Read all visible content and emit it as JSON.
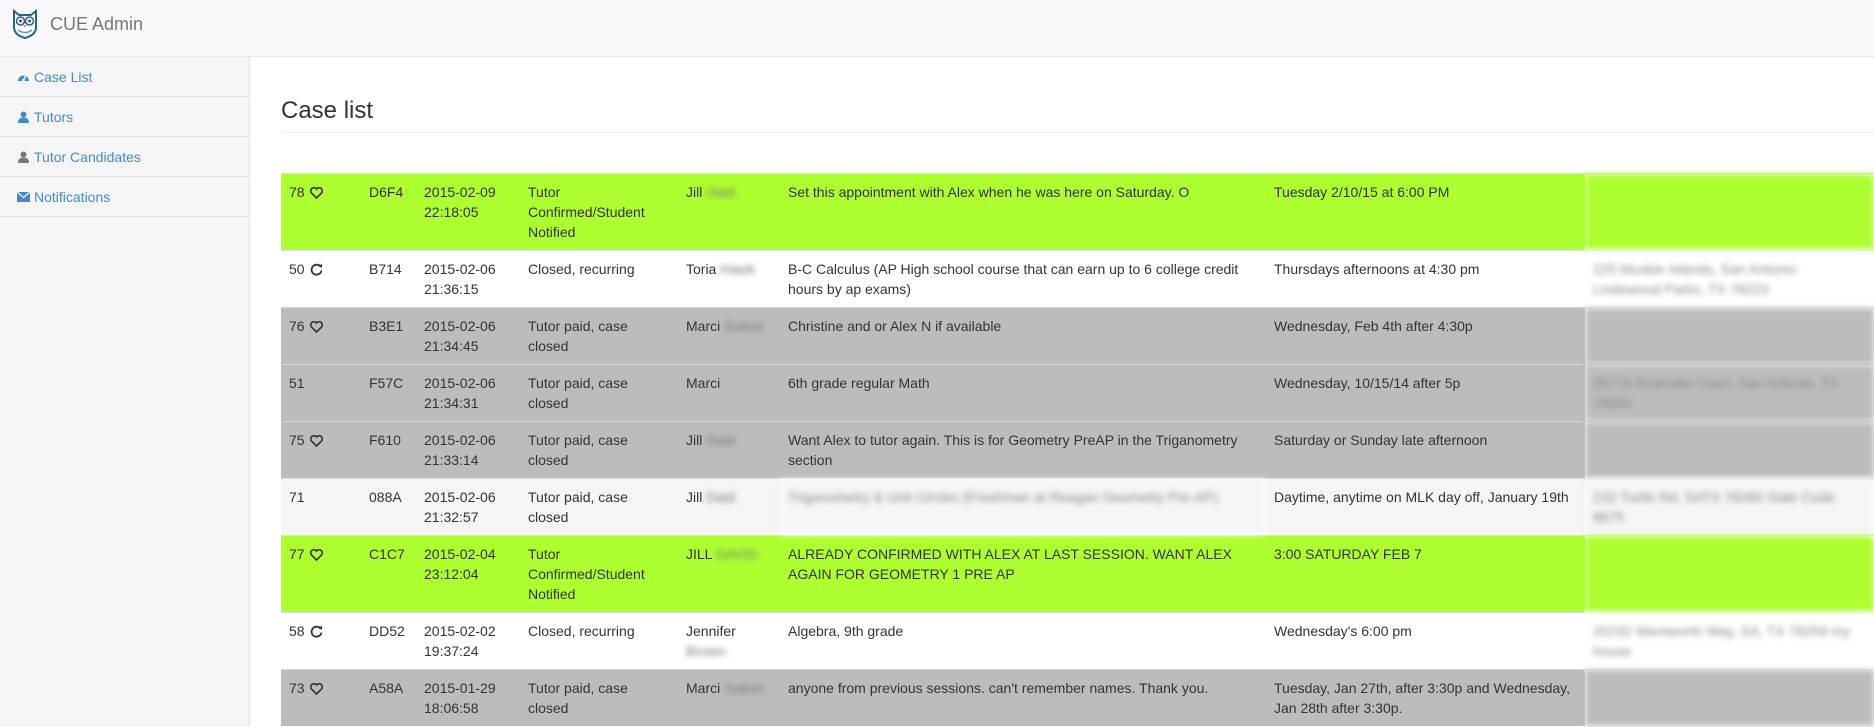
{
  "app": {
    "title": "CUE Admin",
    "logo_icon": "owl-logo-icon"
  },
  "sidebar": {
    "items": [
      {
        "label": "Case List",
        "icon": "dashboard-icon"
      },
      {
        "label": "Tutors",
        "icon": "user-icon"
      },
      {
        "label": "Tutor Candidates",
        "icon": "user-icon"
      },
      {
        "label": "Notifications",
        "icon": "envelope-icon"
      }
    ]
  },
  "page": {
    "title": "Case list"
  },
  "colors": {
    "confirmed": "#adff2f",
    "closed_paid": "#bcbcbc",
    "link": "#428bca"
  },
  "cases": [
    {
      "id": "78",
      "icon": "heart",
      "code": "D6F4",
      "date": "2015-02-09",
      "time": "22:18:05",
      "status": "Tutor Confirmed/Student Notified",
      "name": "Jill",
      "name_hidden": "Daid",
      "name_hidden2": "",
      "note": "Set this appointment with Alex when he was here on Saturday. O",
      "schedule": "Tuesday 2/10/15 at 6:00 PM",
      "address": "",
      "row": "green"
    },
    {
      "id": "50",
      "icon": "refresh",
      "code": "B714",
      "date": "2015-02-06",
      "time": "21:36:15",
      "status": "Closed, recurring",
      "name": "Toria",
      "name_hidden": "Hawk",
      "name_hidden2": "",
      "note": "B-C Calculus (AP High school course that can earn up to 6 college credit hours by ap exams)",
      "schedule": "Thursdays afternoons at 4:30 pm",
      "address": "225 Muskie Islands, San Antonio Lindewood Parks, TX 78223",
      "row": "white"
    },
    {
      "id": "76",
      "icon": "heart",
      "code": "B3E1",
      "date": "2015-02-06",
      "time": "21:34:45",
      "status": "Tutor paid, case closed",
      "name": "Marci",
      "name_hidden": "Galvin",
      "name_hidden2": "",
      "note": "Christine and or Alex N if available",
      "schedule": "Wednesday, Feb 4th after 4:30p",
      "address": "",
      "row": "grey"
    },
    {
      "id": "51",
      "icon": "",
      "code": "F57C",
      "date": "2015-02-06",
      "time": "21:34:31",
      "status": "Tutor paid, case closed",
      "name": "Marci",
      "name_hidden": "",
      "name_hidden2": "",
      "note": "6th grade regular Math",
      "schedule": "Wednesday, 10/15/14 after 5p",
      "address": "28774 Roanoke Court, San Antonio, TX 78260",
      "row": "grey"
    },
    {
      "id": "75",
      "icon": "heart",
      "code": "F610",
      "date": "2015-02-06",
      "time": "21:33:14",
      "status": "Tutor paid, case closed",
      "name": "Jill",
      "name_hidden": "Daid",
      "name_hidden2": "",
      "note": "Want Alex to tutor again. This is for Geometry PreAP in the Triganometry section",
      "schedule": "Saturday or Sunday late afternoon",
      "address": "",
      "row": "grey"
    },
    {
      "id": "71",
      "icon": "",
      "code": "088A",
      "date": "2015-02-06",
      "time": "21:32:57",
      "status": "Tutor paid, case closed",
      "name": "Jill",
      "name_hidden": "Daid",
      "name_hidden2": "",
      "note": "Trigonometry & Unit Circles (Freshman at Reagan Geometry Pre-AP)",
      "schedule": "Daytime, anytime on MLK day off, January 19th",
      "address": "232 Turtle Rd, SATX 78260 Gate Code 8675",
      "row": "light",
      "note_hidden": true
    },
    {
      "id": "77",
      "icon": "heart",
      "code": "C1C7",
      "date": "2015-02-04",
      "time": "23:12:04",
      "status": "Tutor Confirmed/Student Notified",
      "name": "JILL",
      "name_hidden": "DAVID",
      "name_hidden2": "",
      "note": "ALREADY CONFIRMED WITH ALEX AT LAST SESSION. WANT ALEX AGAIN FOR GEOMETRY 1 PRE AP",
      "schedule": "3:00 SATURDAY FEB 7",
      "address": "",
      "row": "green"
    },
    {
      "id": "58",
      "icon": "refresh",
      "code": "DD52",
      "date": "2015-02-02",
      "time": "19:37:24",
      "status": "Closed, recurring",
      "name": "Jennifer",
      "name_hidden": "",
      "name_hidden2": "Brown",
      "note": "Algebra, 9th grade",
      "schedule": "Wednesday's 6:00 pm",
      "address": "20232 Wentworth Way, SA, TX 78259 my house",
      "row": "white"
    },
    {
      "id": "73",
      "icon": "heart",
      "code": "A58A",
      "date": "2015-01-29",
      "time": "18:06:58",
      "status": "Tutor paid, case closed",
      "name": "Marci",
      "name_hidden": "Galvin",
      "name_hidden2": "",
      "note": "anyone from previous sessions. can't remember names. Thank you.",
      "schedule": "Tuesday, Jan 27th, after 3:30p and Wednesday, Jan 28th after 3:30p.",
      "address": "",
      "row": "grey"
    }
  ]
}
